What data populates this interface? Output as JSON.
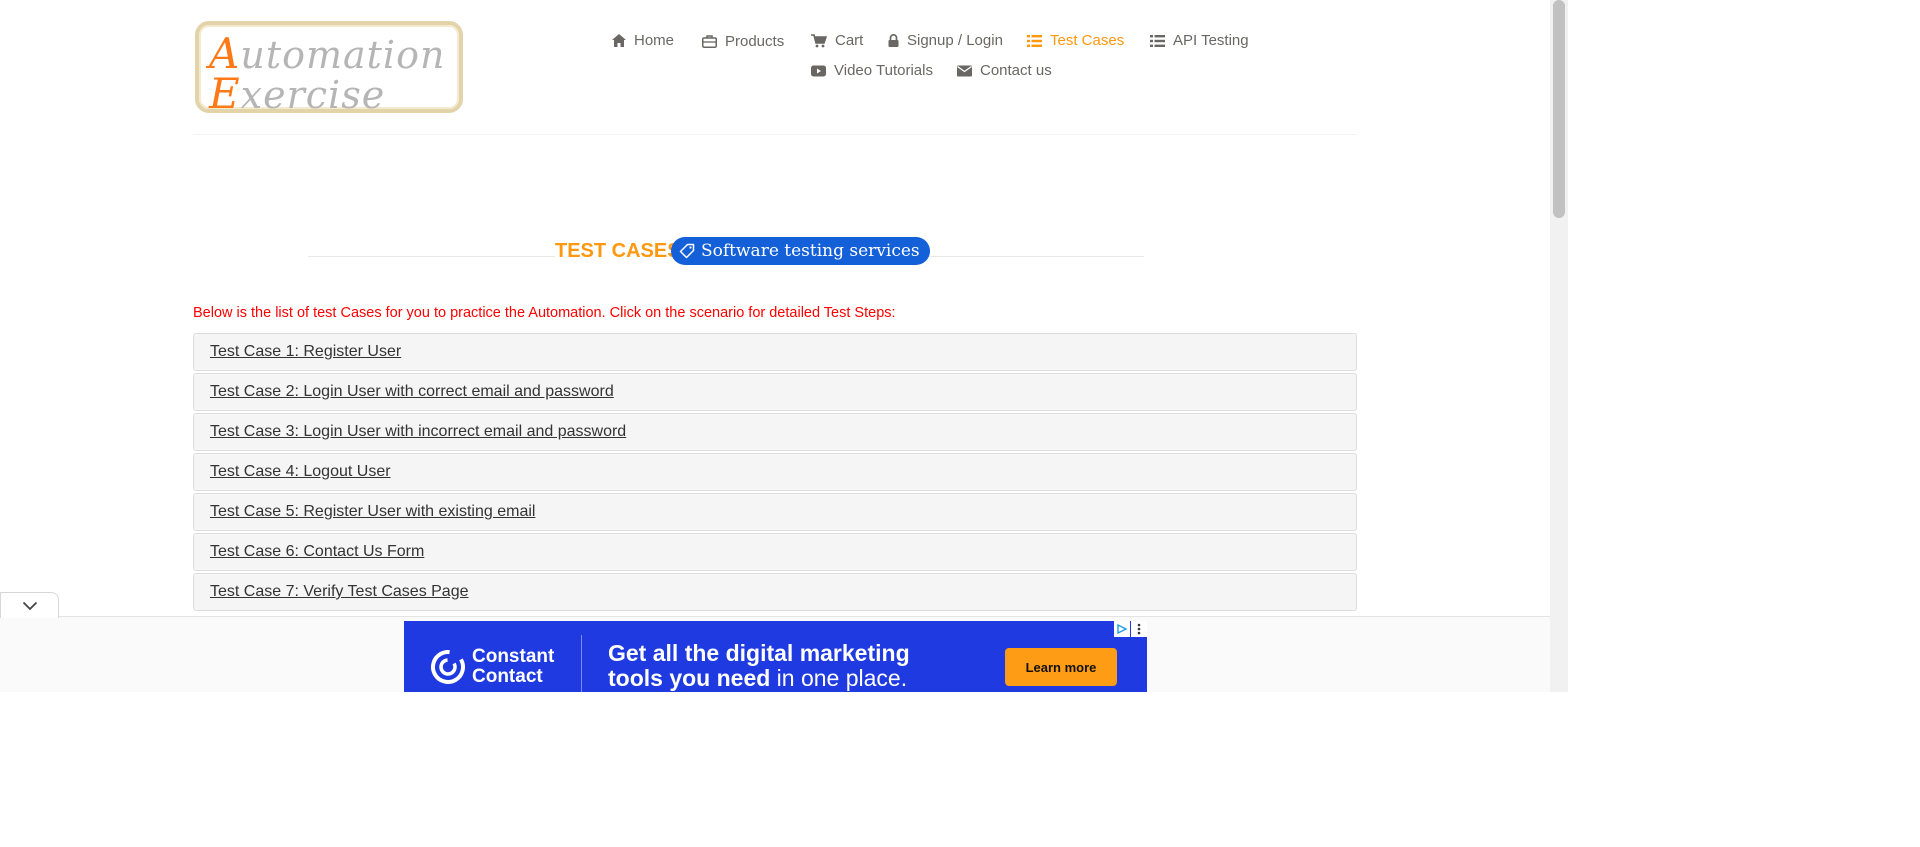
{
  "logo": {
    "line1_cap": "A",
    "line1_rest": "utomation",
    "line2_cap": "E",
    "line2_rest": "xercise"
  },
  "nav": {
    "items": [
      {
        "label": "Home",
        "icon": "home-icon"
      },
      {
        "label": "Products",
        "icon": "briefcase-icon"
      },
      {
        "label": "Cart",
        "icon": "cart-icon"
      },
      {
        "label": "Signup / Login",
        "icon": "lock-icon"
      },
      {
        "label": "Test Cases",
        "icon": "list-icon",
        "active": true
      },
      {
        "label": "API Testing",
        "icon": "list-icon"
      },
      {
        "label": "Video Tutorials",
        "icon": "youtube-icon"
      },
      {
        "label": "Contact us",
        "icon": "envelope-icon"
      }
    ]
  },
  "title": {
    "heading": "TEST CASES",
    "badge": "Software testing services",
    "badge_icon": "tag-icon"
  },
  "intro": "Below is the list of test Cases for you to practice the Automation. Click on the scenario for detailed Test Steps:",
  "test_cases": [
    "Test Case 1: Register User",
    "Test Case 2: Login User with correct email and password",
    "Test Case 3: Login User with incorrect email and password",
    "Test Case 4: Logout User",
    "Test Case 5: Register User with existing email",
    "Test Case 6: Contact Us Form",
    "Test Case 7: Verify Test Cases Page"
  ],
  "ad": {
    "brand_line1": "Constant",
    "brand_line2": "Contact",
    "headline_bold1": "Get all the digital marketing",
    "headline_bold2": "tools you need",
    "headline_regular": " in one place.",
    "cta": "Learn more",
    "choices_icon": "adchoices-icon",
    "menu_icon": "more-vertical-icon"
  },
  "colors": {
    "accent": "#fe980f",
    "nav_text": "#696763",
    "intro_red": "#ff0000",
    "badge_blue": "#1460d8",
    "ad_blue": "#1e3ae0",
    "ad_cta": "#ff9c15"
  }
}
